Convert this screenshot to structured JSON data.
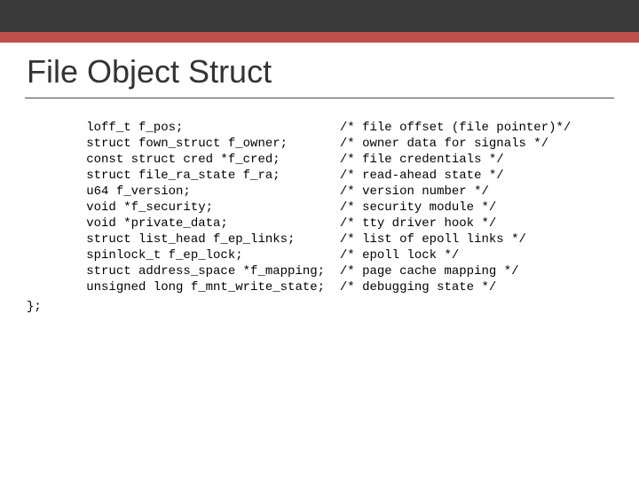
{
  "title": "File Object Struct",
  "indent": "        ",
  "decl_width": 34,
  "rows": [
    {
      "decl": "loff_t f_pos;",
      "comment": "/* file offset (file pointer)*/"
    },
    {
      "decl": "struct fown_struct f_owner;",
      "comment": "/* owner data for signals */"
    },
    {
      "decl": "const struct cred *f_cred;",
      "comment": "/* file credentials */"
    },
    {
      "decl": "struct file_ra_state f_ra;",
      "comment": "/* read-ahead state */"
    },
    {
      "decl": "u64 f_version;",
      "comment": "/* version number */"
    },
    {
      "decl": "void *f_security;",
      "comment": "/* security module */"
    },
    {
      "decl": "void *private_data;",
      "comment": "/* tty driver hook */"
    },
    {
      "decl": "struct list_head f_ep_links;",
      "comment": "/* list of epoll links */"
    },
    {
      "decl": "spinlock_t f_ep_lock;",
      "comment": "/* epoll lock */"
    },
    {
      "decl": "struct address_space *f_mapping;",
      "comment": "/* page cache mapping */"
    },
    {
      "decl": "unsigned long f_mnt_write_state;",
      "comment": "/* debugging state */"
    }
  ],
  "closer": "};"
}
